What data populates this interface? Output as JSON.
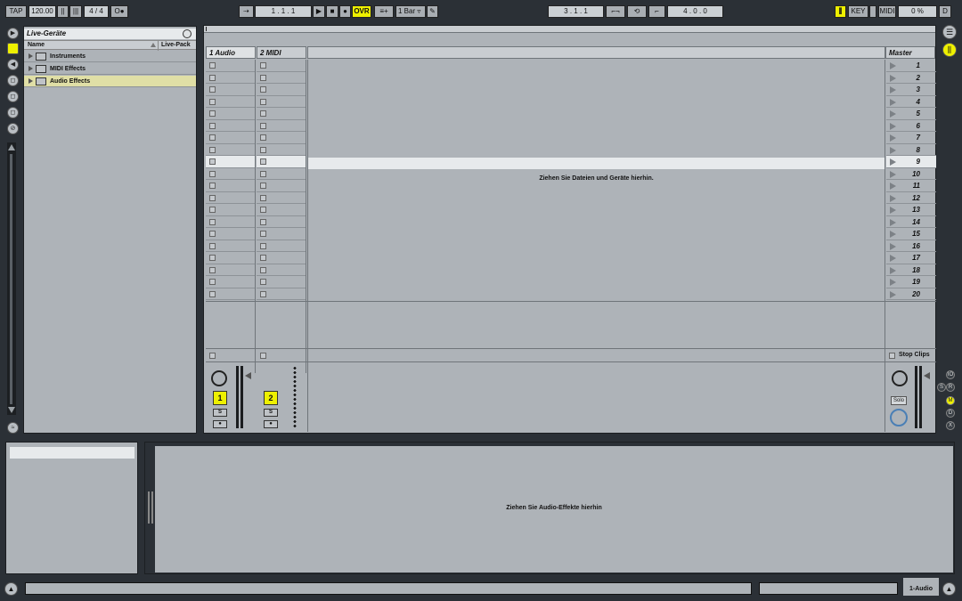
{
  "transport": {
    "tap": "TAP",
    "tempo": "120.00",
    "signature": "4 / 4",
    "follow": "O●",
    "position": "1 .  1 .  1",
    "ovr": "OVR",
    "quantize": "1 Bar",
    "loop_start": "3 .  1 .  1",
    "loop_length": "4 .  0 .  0",
    "key": "KEY",
    "midi": "MIDI",
    "cpu": "0 %",
    "disk": "D"
  },
  "browser": {
    "title": "Live-Geräte",
    "col_name": "Name",
    "col_pack": "Live-Pack",
    "items": [
      {
        "label": "Instruments"
      },
      {
        "label": "MIDI Effects"
      },
      {
        "label": "Audio Effects"
      }
    ]
  },
  "session": {
    "tracks": [
      {
        "name": "1 Audio",
        "number": "1",
        "solo": "S"
      },
      {
        "name": "2 MIDI",
        "number": "2",
        "solo": "S"
      }
    ],
    "master": "Master",
    "drop_hint": "Ziehen Sie Dateien und Geräte hierhin.",
    "stop_clips": "Stop Clips",
    "solo_label": "Solo",
    "scenes": [
      "1",
      "2",
      "3",
      "4",
      "5",
      "6",
      "7",
      "8",
      "9",
      "10",
      "11",
      "12",
      "13",
      "14",
      "15",
      "16",
      "17",
      "18",
      "19",
      "20"
    ]
  },
  "side_buttons": [
    "IO",
    "S",
    "R",
    "M",
    "D",
    "X"
  ],
  "detail": {
    "drop_hint": "Ziehen Sie Audio-Effekte hierhin"
  },
  "status": {
    "track_name": "1-Audio"
  },
  "colors": {
    "background": "#2b3036",
    "panel": "#aeb3b8",
    "accent_yellow": "#eef000",
    "selected_row": "#e0dfa6"
  }
}
